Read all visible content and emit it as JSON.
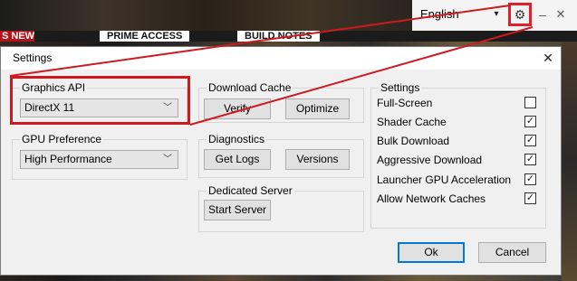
{
  "launcher": {
    "language": "English",
    "nav": {
      "new": "S NEW",
      "prime_access": "PRIME ACCESS",
      "build_notes": "BUILD NOTES"
    },
    "icons": {
      "settings": "gear-icon",
      "minimize": "minimize-icon",
      "close": "close-icon",
      "dropdown": "chevron-down-icon"
    }
  },
  "dialog": {
    "title": "Settings",
    "graphics_api": {
      "label": "Graphics API",
      "selected": "DirectX 11"
    },
    "gpu_preference": {
      "label": "GPU Preference",
      "selected": "High Performance"
    },
    "download_cache": {
      "label": "Download Cache",
      "verify": "Verify",
      "optimize": "Optimize"
    },
    "diagnostics": {
      "label": "Diagnostics",
      "get_logs": "Get Logs",
      "versions": "Versions"
    },
    "dedicated_server": {
      "label": "Dedicated Server",
      "start_server": "Start Server"
    },
    "settings_group": {
      "label": "Settings",
      "options": [
        {
          "label": "Full-Screen",
          "checked": false
        },
        {
          "label": "Shader Cache",
          "checked": true
        },
        {
          "label": "Bulk Download",
          "checked": true
        },
        {
          "label": "Aggressive Download",
          "checked": true
        },
        {
          "label": "Launcher GPU Acceleration",
          "checked": true
        },
        {
          "label": "Allow Network Caches",
          "checked": true
        }
      ]
    },
    "ok": "Ok",
    "cancel": "Cancel"
  },
  "colors": {
    "highlight": "#d0191f",
    "dialog_bg": "#f0f0f0",
    "default_button_border": "#0078d7"
  }
}
